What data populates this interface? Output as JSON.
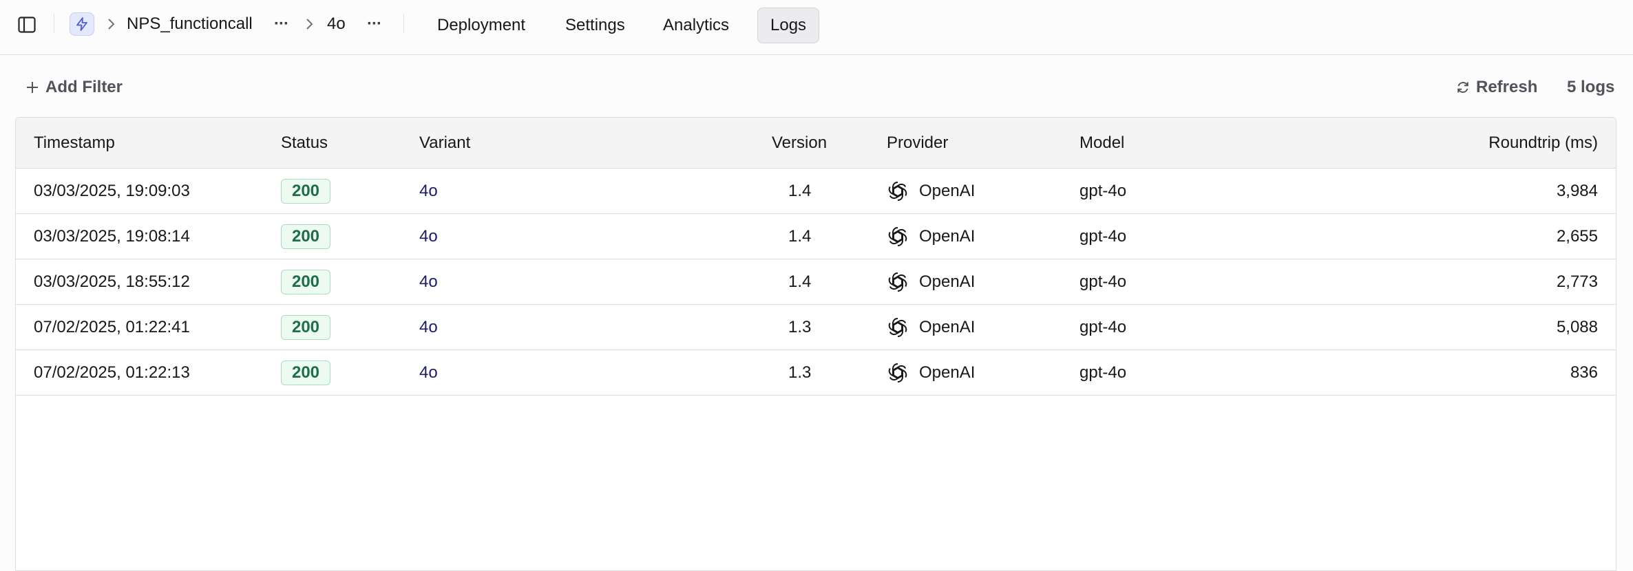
{
  "breadcrumb": {
    "prompt_name": "NPS_functioncall",
    "more_1": "···",
    "variant_name": "4o",
    "more_2": "···"
  },
  "tabs": [
    {
      "label": "Deployment",
      "active": false
    },
    {
      "label": "Settings",
      "active": false
    },
    {
      "label": "Analytics",
      "active": false
    },
    {
      "label": "Logs",
      "active": true
    }
  ],
  "toolbar": {
    "add_filter_label": "Add Filter",
    "refresh_label": "Refresh",
    "log_count": "5 logs"
  },
  "table": {
    "columns": [
      "Timestamp",
      "Status",
      "Variant",
      "Version",
      "Provider",
      "Model",
      "Roundtrip (ms)"
    ],
    "rows": [
      {
        "timestamp": "03/03/2025, 19:09:03",
        "status": "200",
        "variant": "4o",
        "version": "1.4",
        "provider": "OpenAI",
        "model": "gpt-4o",
        "roundtrip": "3,984"
      },
      {
        "timestamp": "03/03/2025, 19:08:14",
        "status": "200",
        "variant": "4o",
        "version": "1.4",
        "provider": "OpenAI",
        "model": "gpt-4o",
        "roundtrip": "2,655"
      },
      {
        "timestamp": "03/03/2025, 18:55:12",
        "status": "200",
        "variant": "4o",
        "version": "1.4",
        "provider": "OpenAI",
        "model": "gpt-4o",
        "roundtrip": "2,773"
      },
      {
        "timestamp": "07/02/2025, 01:22:41",
        "status": "200",
        "variant": "4o",
        "version": "1.3",
        "provider": "OpenAI",
        "model": "gpt-4o",
        "roundtrip": "5,088"
      },
      {
        "timestamp": "07/02/2025, 01:22:13",
        "status": "200",
        "variant": "4o",
        "version": "1.3",
        "provider": "OpenAI",
        "model": "gpt-4o",
        "roundtrip": "836"
      }
    ]
  },
  "icons": {
    "sidebar_toggle": "sidebar-toggle-icon",
    "app": "lightning-icon",
    "breadcrumb_separator": "chevron-right-icon",
    "add": "plus-icon",
    "refresh": "refresh-icon",
    "provider": "openai-logo-icon"
  },
  "colors": {
    "status_success_text": "#1f6e48",
    "status_success_bg": "#ecfaf2",
    "variant_link": "#1e1b6b",
    "app_icon_bg": "#e3e8fc",
    "app_icon_fg": "#4f5bd5"
  }
}
